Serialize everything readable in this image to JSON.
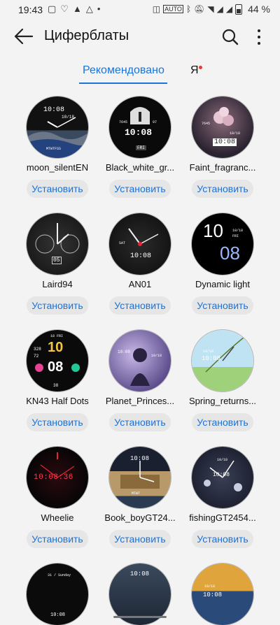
{
  "status": {
    "time": "19:43",
    "battery": "44 %"
  },
  "header": {
    "title": "Циферблаты"
  },
  "tabs": {
    "recommended": "Рекомендовано",
    "me": "Я"
  },
  "install_label": "Установить",
  "watchfaces": [
    {
      "name": "moon_silentEN"
    },
    {
      "name": "Black_white_gr..."
    },
    {
      "name": "Faint_fragranc..."
    },
    {
      "name": "Laird94"
    },
    {
      "name": "AN01"
    },
    {
      "name": "Dynamic light"
    },
    {
      "name": "KN43 Half Dots"
    },
    {
      "name": "Planet_Princes..."
    },
    {
      "name": "Spring_returns..."
    },
    {
      "name": "Wheelie"
    },
    {
      "name": "Book_boyGT24..."
    },
    {
      "name": "fishingGT2454..."
    }
  ],
  "face_text": {
    "f0_time": "10:08",
    "f0_date": "10/18",
    "f0_steps": "MTWTFSS",
    "f1_time": "10:08",
    "f1_date": "FRI",
    "f1_steps": "7645",
    "f1_hr": "97",
    "f2_time": "10:08",
    "f2_date": "10/18",
    "f2_steps": "7645",
    "f3_date": "05",
    "f4_time": "10:08",
    "f4_label": "SAT",
    "f5_hour": "10",
    "f5_min": "08",
    "f5_date": "10/18",
    "f5_day": "FRI",
    "f6_hour": "10",
    "f6_min": "08",
    "f6_day": "18 FRI",
    "f6_a": "328",
    "f6_b": "72",
    "f6_c": "38",
    "f7_time": "10:08",
    "f7_date": "10/18",
    "f8_time": "10:08",
    "f8_date": "10/18",
    "f9_time": "10:08:36",
    "f10_time": "10:08",
    "f10_date": "MTWT",
    "f11_time": "10:08",
    "f11_date": "10/18",
    "f12_date": "31 / Sunday",
    "f12_time": "10:08",
    "f13_time": "10:08",
    "f14_time": "10:08",
    "f14_date": "10/18"
  }
}
